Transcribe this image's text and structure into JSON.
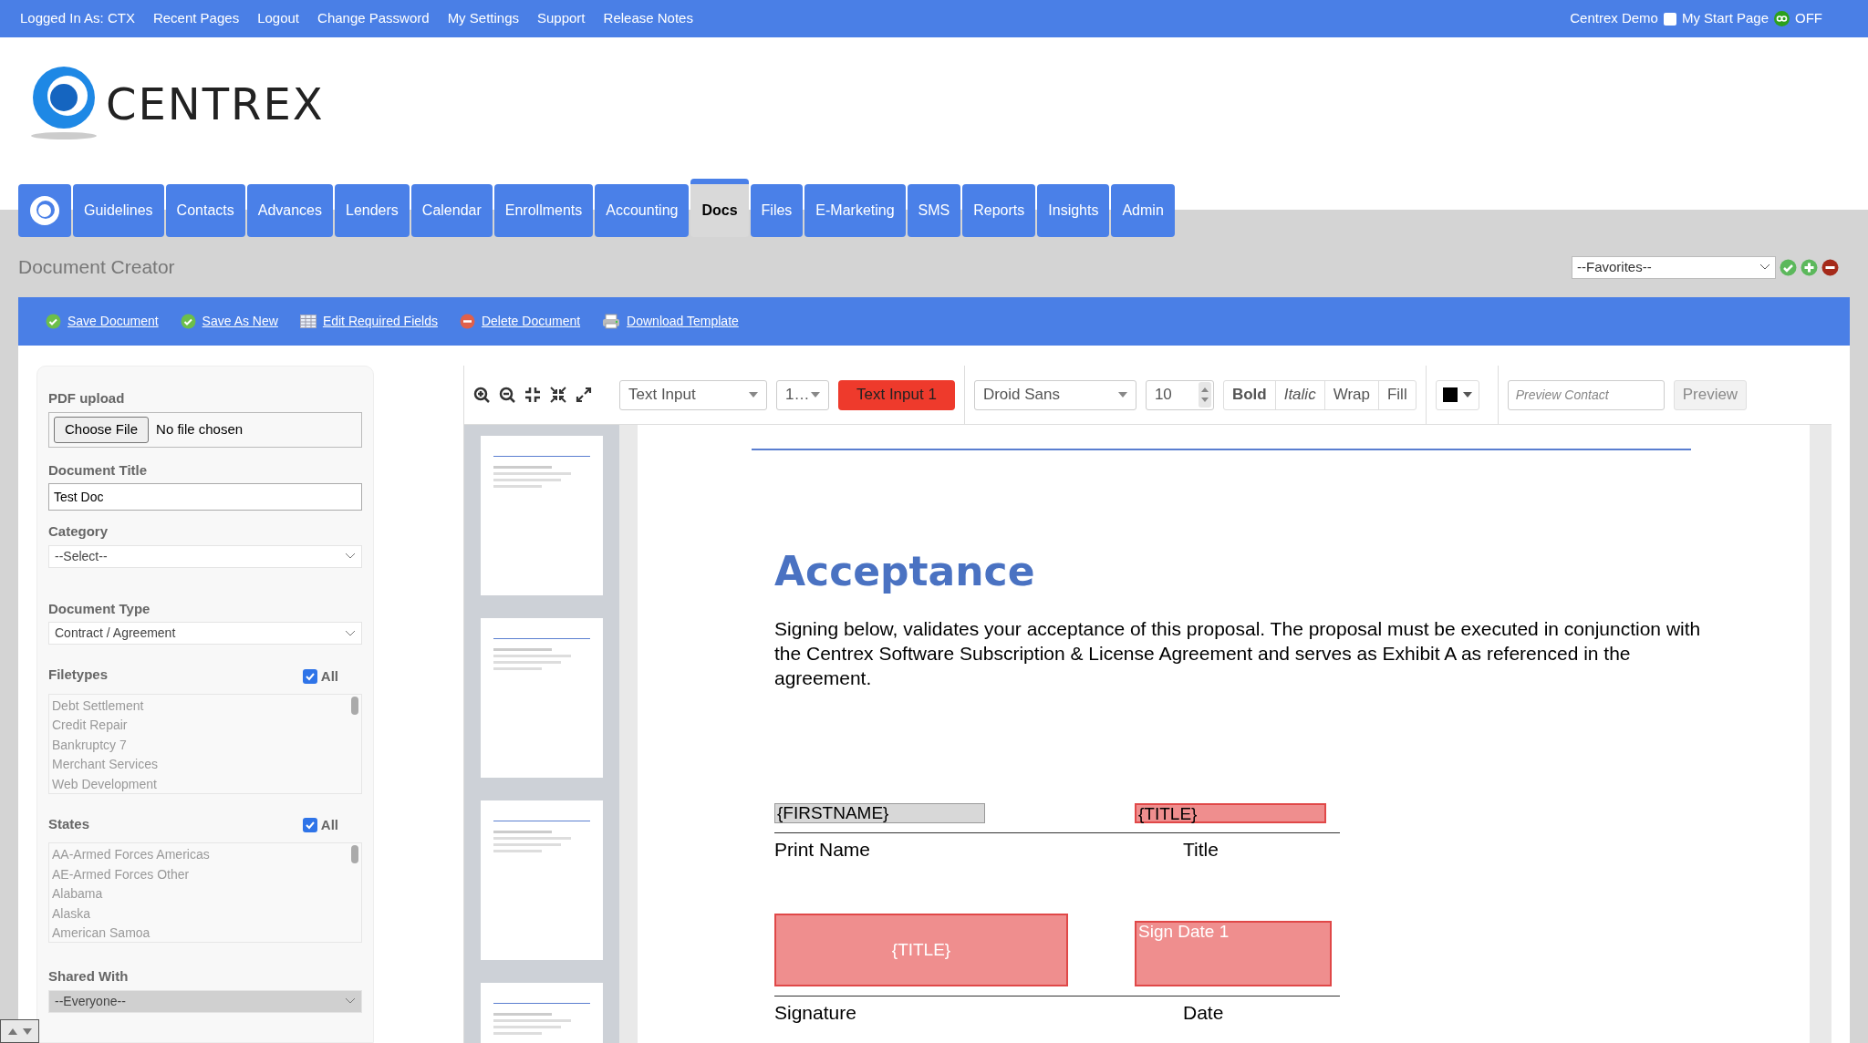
{
  "top_bar": {
    "links": [
      "Logged In As: CTX",
      "Recent Pages",
      "Logout",
      "Change Password",
      "My Settings",
      "Support",
      "Release Notes"
    ],
    "account": "Centrex Demo",
    "my_start_page": {
      "label": "My Start Page",
      "checked": false
    },
    "qb_status": "OFF"
  },
  "logo": {
    "text": "CENTREX"
  },
  "nav_tabs": [
    {
      "label": "Guidelines",
      "selected": false
    },
    {
      "label": "Contacts",
      "selected": false
    },
    {
      "label": "Advances",
      "selected": false
    },
    {
      "label": "Lenders",
      "selected": false
    },
    {
      "label": "Calendar",
      "selected": false
    },
    {
      "label": "Enrollments",
      "selected": false
    },
    {
      "label": "Accounting",
      "selected": false
    },
    {
      "label": "Docs",
      "selected": true
    },
    {
      "label": "Files",
      "selected": false
    },
    {
      "label": "E-Marketing",
      "selected": false
    },
    {
      "label": "SMS",
      "selected": false
    },
    {
      "label": "Reports",
      "selected": false
    },
    {
      "label": "Insights",
      "selected": false
    },
    {
      "label": "Admin",
      "selected": false
    }
  ],
  "page_title": "Document Creator",
  "favorites": {
    "value": "--Favorites--"
  },
  "actions": [
    {
      "label": "Save Document",
      "kind": "check"
    },
    {
      "label": "Save As New",
      "kind": "check"
    },
    {
      "label": "Edit Required Fields",
      "kind": "table"
    },
    {
      "label": "Delete Document",
      "kind": "delete"
    },
    {
      "label": "Download Template",
      "kind": "printer"
    }
  ],
  "form": {
    "pdf_upload": {
      "label": "PDF upload",
      "button": "Choose File",
      "status": "No file chosen"
    },
    "document_title": {
      "label": "Document Title",
      "value": "Test Doc"
    },
    "category": {
      "label": "Category",
      "value": "--Select--"
    },
    "document_type": {
      "label": "Document Type",
      "value": "Contract / Agreement"
    },
    "filetypes": {
      "label": "Filetypes",
      "all_label": "All",
      "all_checked": true,
      "items": [
        "Debt Settlement",
        "Credit Repair",
        "Bankruptcy 7",
        "Merchant Services",
        "Web Development"
      ]
    },
    "states": {
      "label": "States",
      "all_label": "All",
      "all_checked": true,
      "items": [
        "AA-Armed Forces Americas",
        "AE-Armed Forces Other",
        "Alabama",
        "Alaska",
        "American Samoa"
      ]
    },
    "shared_with": {
      "label": "Shared With",
      "value": "--Everyone--"
    }
  },
  "editor_toolbar": {
    "field_type": "Text Input",
    "page": "1…",
    "field_name": "Text Input 1",
    "font": "Droid Sans",
    "size": "10",
    "styles": [
      {
        "label": "Bold",
        "kind": "bold"
      },
      {
        "label": "Italic",
        "kind": "italic"
      },
      {
        "label": "Wrap",
        "kind": "plain"
      },
      {
        "label": "Fill",
        "kind": "plain"
      }
    ],
    "preview_contact": {
      "placeholder": "Preview Contact"
    },
    "preview_button": {
      "label": "Preview",
      "disabled": true
    }
  },
  "document": {
    "heading": "Acceptance",
    "paragraph": "Signing below, validates your acceptance of this proposal. The proposal must be executed in conjunction with the Centrex Software Subscription & License Agreement and serves as Exhibit A as referenced in the agreement.",
    "row_1": {
      "fields": [
        {
          "text": "{FIRSTNAME}",
          "kind": "plain"
        },
        {
          "text": "{TITLE}",
          "kind": "required"
        }
      ],
      "labels": [
        "Print Name",
        "Title"
      ]
    },
    "row_2": {
      "fields": [
        {
          "text": "{TITLE}",
          "kind": "required"
        },
        {
          "text": "Sign Date 1",
          "kind": "required"
        }
      ],
      "labels": [
        "Signature",
        "Date"
      ]
    }
  }
}
